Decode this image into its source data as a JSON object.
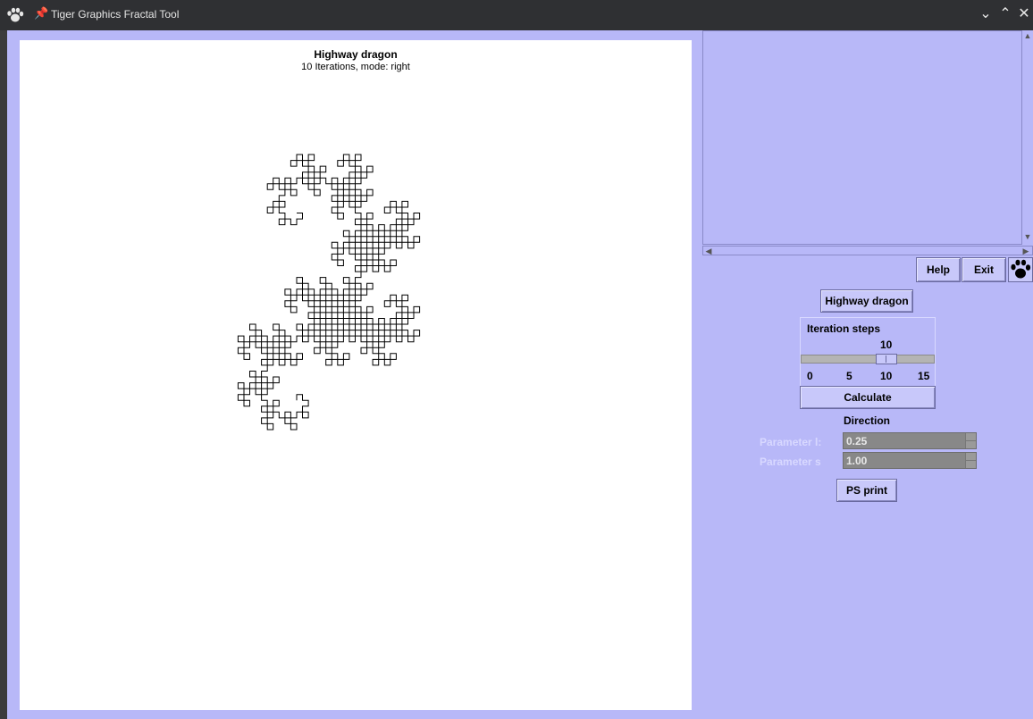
{
  "window": {
    "title": "Tiger Graphics Fractal Tool",
    "controls": {
      "minimize": "⌄",
      "maximize": "⌃",
      "close": "✕"
    },
    "pin_glyph": "📌"
  },
  "plot": {
    "title": "Highway dragon",
    "subtitle": "10 Iterations, mode: right",
    "iterations": 10,
    "mode": "right"
  },
  "toolbar": {
    "help_label": "Help",
    "exit_label": "Exit",
    "logo_icon": "paw-icon"
  },
  "controls": {
    "fractal_button_label": "Highway dragon",
    "iteration_steps_label": "Iteration steps",
    "iteration_value": "10",
    "slider_min": 0,
    "slider_max": 15,
    "slider_ticks": [
      "0",
      "5",
      "10",
      "15"
    ],
    "calculate_label": "Calculate",
    "direction_label": "Direction",
    "parameter_l_label": "Parameter l:",
    "parameter_l_value": "0.25",
    "parameter_s_label": "Parameter s",
    "parameter_s_value": "1.00",
    "ps_print_label": "PS print"
  },
  "colors": {
    "background": "#b8b8f8",
    "button": "#c8c8fa",
    "titlebar": "#2f3033",
    "disabled_field": "#888888"
  }
}
